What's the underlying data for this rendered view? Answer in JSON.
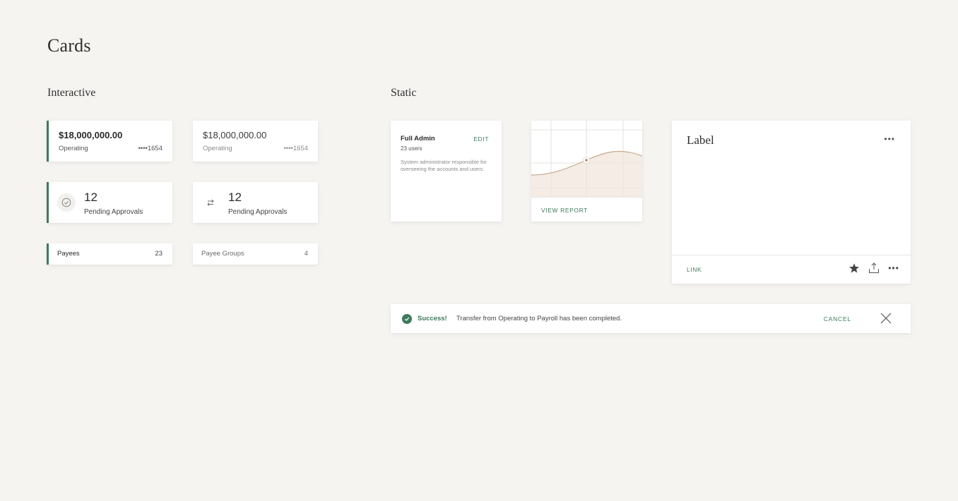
{
  "page": {
    "title": "Cards"
  },
  "sections": {
    "interactive": "Interactive",
    "static": "Static"
  },
  "account_cards": [
    {
      "amount": "$18,000,000.00",
      "name": "Operating",
      "mask": "••••1654"
    },
    {
      "amount": "$18,000,000.00",
      "name": "Operating",
      "mask": "••••1654"
    }
  ],
  "pending_cards": [
    {
      "count": "12",
      "label": "Pending Approvals",
      "icon": "check-circle-icon"
    },
    {
      "count": "12",
      "label": "Pending Approvals",
      "icon": "swap-arrows-icon"
    }
  ],
  "payee_cards": [
    {
      "label": "Payees",
      "count": "23"
    },
    {
      "label": "Payee Groups",
      "count": "4"
    }
  ],
  "admin_card": {
    "title": "Full Admin",
    "edit_label": "EDIT",
    "users": "23 users",
    "description": "System administrator responsible for overseeing the accounts and users."
  },
  "chart_card": {
    "link_label": "VIEW REPORT"
  },
  "label_card": {
    "title": "Label",
    "link_label": "LINK",
    "more_glyph": "•••"
  },
  "toast": {
    "status": "Success!",
    "message": "Transfer from Operating to Payroll has been completed.",
    "cancel_label": "CANCEL"
  },
  "colors": {
    "accent": "#3e7a5c",
    "background": "#f5f4f1",
    "chart_fill": "#f0e6dc",
    "chart_line": "#c7a98c"
  }
}
